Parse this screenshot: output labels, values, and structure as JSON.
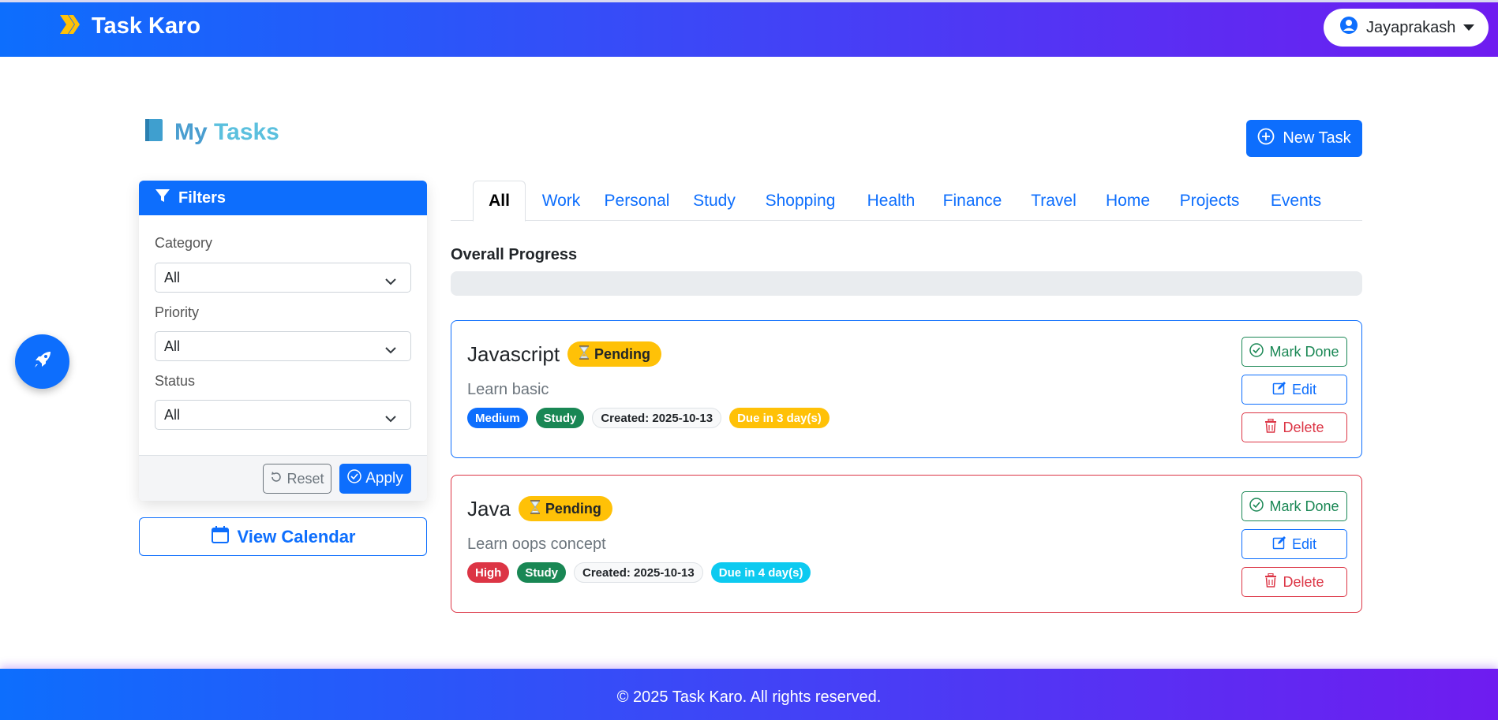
{
  "navbar": {
    "brand": "Task Karo",
    "user_name": "Jayaprakash"
  },
  "page": {
    "title_word1": "My",
    "title_word2": "Tasks",
    "new_task_label": "New Task"
  },
  "filters": {
    "header": "Filters",
    "category_label": "Category",
    "category_value": "All",
    "priority_label": "Priority",
    "priority_value": "All",
    "status_label": "Status",
    "status_value": "All",
    "reset_label": "Reset",
    "apply_label": "Apply"
  },
  "calendar_button": "View Calendar",
  "tabs": [
    "All",
    "Work",
    "Personal",
    "Study",
    "Shopping",
    "Health",
    "Finance",
    "Travel",
    "Home",
    "Projects",
    "Events"
  ],
  "active_tab": "All",
  "progress": {
    "label": "Overall Progress",
    "fraction": 0
  },
  "tasks": [
    {
      "name": "Javascript",
      "status": "Pending",
      "description": "Learn basic",
      "priority": "Medium",
      "category": "Study",
      "created": "Created: 2025-10-13",
      "due": "Due in 3 day(s)"
    },
    {
      "name": "Java",
      "status": "Pending",
      "description": "Learn oops concept",
      "priority": "High",
      "category": "Study",
      "created": "Created: 2025-10-13",
      "due": "Due in 4 day(s)"
    }
  ],
  "actions": {
    "mark_done": "Mark Done",
    "edit": "Edit",
    "delete": "Delete"
  },
  "footer": "© 2025 Task Karo. All rights reserved.",
  "colors": {
    "primary": "#0d6efd",
    "success": "#198754",
    "danger": "#dc3545",
    "warning": "#ffc107",
    "info": "#0dcaf0",
    "gradient_end": "#6f1cf0"
  }
}
